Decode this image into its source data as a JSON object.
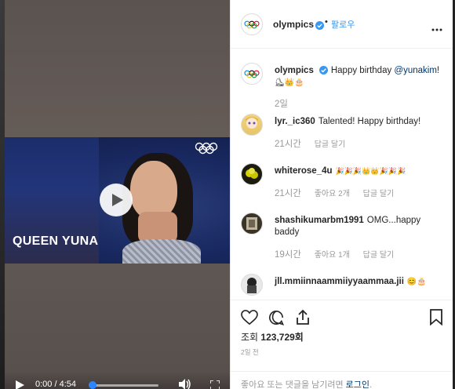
{
  "video": {
    "title": "QUEEN YUNA",
    "time_display": "0:00 / 4:54",
    "progress": 0
  },
  "post": {
    "author": "olympics",
    "follow_label": "팔로우",
    "separator": "•",
    "caption_text": "Happy birthday ",
    "caption_mention": "@yunakim",
    "caption_end": "!",
    "caption_emoji": "⛸👑🎂",
    "caption_time": "2일"
  },
  "comments": [
    {
      "user": "lyr._ic360",
      "text": "Talented! Happy birthday!",
      "time": "21시간",
      "likes": "",
      "reply": "답글 달기"
    },
    {
      "user": "whiterose_4u",
      "text": "🎉🎉🎉👑👑🎉🎉🎉",
      "time": "21시간",
      "likes": "좋아요 2개",
      "reply": "답글 달기"
    },
    {
      "user": "shashikumarbm1991",
      "text": "OMG...happy baddy",
      "time": "19시간",
      "likes": "좋아요 1개",
      "reply": "답글 달기"
    },
    {
      "user": "jll.mmiinnaammiiyyaammaa.jii",
      "text": "😊🎂",
      "time": "",
      "likes": "",
      "reply": ""
    }
  ],
  "stats": {
    "views_label": "조회 ",
    "views_count": "123,729회",
    "posted": "2일 전"
  },
  "comment_prompt": {
    "text": "좋아요 또는 댓글을 남기려면 ",
    "login": "로그인",
    "end": "."
  },
  "colors": {
    "link_blue": "#3897f0",
    "verified_blue": "#3897f0",
    "progress_blue": "#2d86ff"
  },
  "icons": [
    "olympic-rings-icon",
    "verified-icon",
    "more-icon",
    "play-icon",
    "volume-icon",
    "fullscreen-icon",
    "heart-icon",
    "comment-icon",
    "share-icon",
    "bookmark-icon"
  ]
}
